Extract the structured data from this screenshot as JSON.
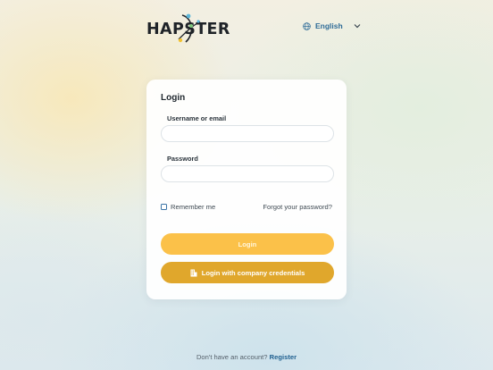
{
  "header": {
    "logo_text": "HAPSTER",
    "language": {
      "icon": "globe-icon",
      "selected": "English",
      "chevron_icon": "chevron-down-icon"
    }
  },
  "login_card": {
    "title": "Login",
    "username": {
      "label": "Username or email",
      "value": "",
      "placeholder": ""
    },
    "password": {
      "label": "Password",
      "value": "",
      "placeholder": ""
    },
    "remember_me": {
      "label": "Remember me",
      "checked": false
    },
    "forgot_password": "Forgot your password?",
    "login_button": "Login",
    "company_button": {
      "icon": "building-icon",
      "label": "Login with company credentials"
    }
  },
  "footer": {
    "prompt": "Don't have an account?",
    "register_link": "Register"
  },
  "colors": {
    "accent_yellow": "#fbc149",
    "accent_gold": "#e0a72c",
    "link_blue": "#2f6c98"
  }
}
